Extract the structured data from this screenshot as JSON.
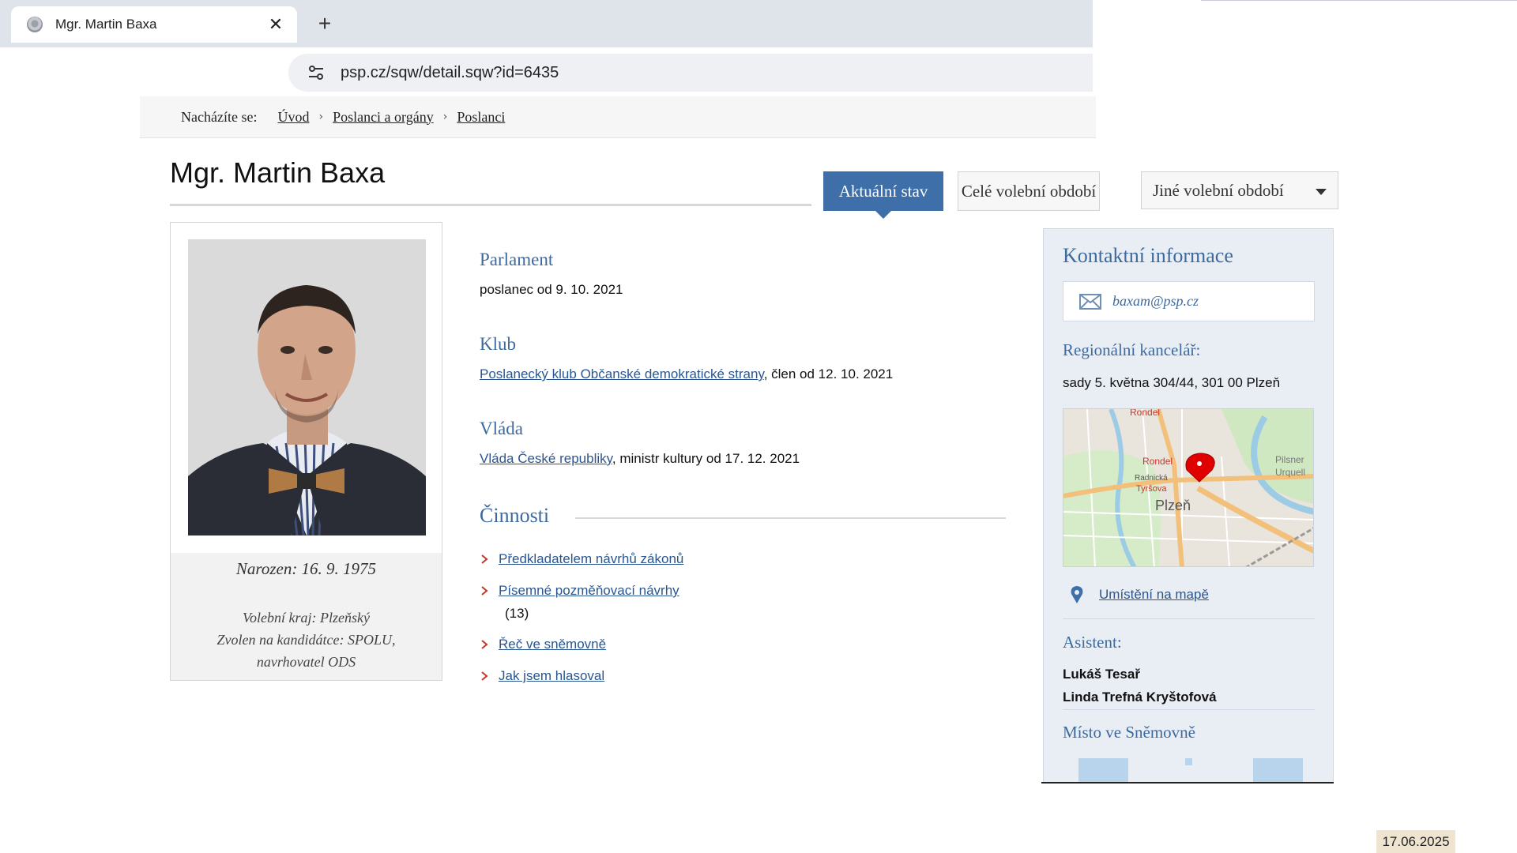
{
  "browser": {
    "tab_title": "Mgr. Martin Baxa",
    "tab_close": "✕",
    "new_tab": "+",
    "url": "psp.cz/sqw/detail.sqw?id=6435"
  },
  "breadcrumb": {
    "label": "Nacházíte se:",
    "items": [
      "Úvod",
      "Poslanci a orgány",
      "Poslanci"
    ],
    "separator": "›"
  },
  "page": {
    "title": "Mgr. Martin Baxa",
    "tabs": {
      "current": "Aktuální stav",
      "full_term": "Celé volební období",
      "other_term": "Jiné volební období"
    }
  },
  "profile": {
    "born": "Narozen: 16. 9. 1975",
    "region": "Volební kraj: Plzeňský",
    "elected_line1": "Zvolen na kandidátce: SPOLU,",
    "elected_line2": "navrhovatel ODS"
  },
  "sections": {
    "parliament": {
      "heading": "Parlament",
      "text": "poslanec od 9. 10. 2021"
    },
    "club": {
      "heading": "Klub",
      "link": "Poslanecký klub Občanské demokratické strany",
      "text": ", člen od 12. 10. 2021"
    },
    "government": {
      "heading": "Vláda",
      "link": "Vláda České republiky",
      "text": ", ministr kultury od 17. 12. 2021"
    },
    "activities": {
      "heading": "Činnosti",
      "items": [
        {
          "label": "Předkladatelem návrhů zákonů"
        },
        {
          "label": "Písemné pozměňovací návrhy",
          "count": "(13)"
        },
        {
          "label": "Řeč ve sněmovně"
        },
        {
          "label": "Jak jsem hlasoval"
        }
      ]
    }
  },
  "contact": {
    "heading": "Kontaktní informace",
    "email": "baxam@psp.cz",
    "office_label": "Regionální kancelář:",
    "office_address": "sady 5. května 304/44, 301 00  Plzeň",
    "map_labels": [
      "Rondel",
      "Rondel",
      "Radnická",
      "Tyršova",
      "Plzeň",
      "Pilsner",
      "Urquell"
    ],
    "map_link": "Umístění na mapě",
    "assistant_label": "Asistent:",
    "assistants": [
      "Lukáš Tesař",
      "Linda Trefná Kryštofová"
    ],
    "seat_label": "Místo ve Sněmovně"
  },
  "overlay_date": "17.06.2025",
  "colors": {
    "accent": "#3e6fa9",
    "heading_blue": "#3d6a9e",
    "chevron_red": "#c0392b"
  }
}
